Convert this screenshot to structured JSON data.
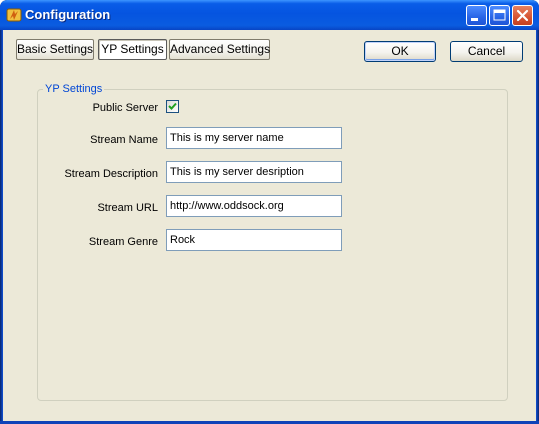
{
  "window": {
    "title": "Configuration",
    "icon": "app-icon"
  },
  "tabs": [
    {
      "label": "Basic Settings",
      "selected": false
    },
    {
      "label": "YP Settings",
      "selected": true
    },
    {
      "label": "Advanced Settings",
      "selected": false
    }
  ],
  "buttons": {
    "ok": "OK",
    "cancel": "Cancel"
  },
  "group": {
    "title": "YP Settings"
  },
  "fields": {
    "public_server": {
      "label": "Public Server",
      "checked": true
    },
    "stream_name": {
      "label": "Stream Name",
      "value": "This is my server name"
    },
    "stream_description": {
      "label": "Stream Description",
      "value": "This is my server desription"
    },
    "stream_url": {
      "label": "Stream URL",
      "value": "http://www.oddsock.org"
    },
    "stream_genre": {
      "label": "Stream Genre",
      "value": "Rock"
    }
  },
  "colors": {
    "titlebar": "#0554e0",
    "group_title": "#0046d5",
    "checkmark": "#21a121",
    "window_bg": "#ece9d8"
  }
}
